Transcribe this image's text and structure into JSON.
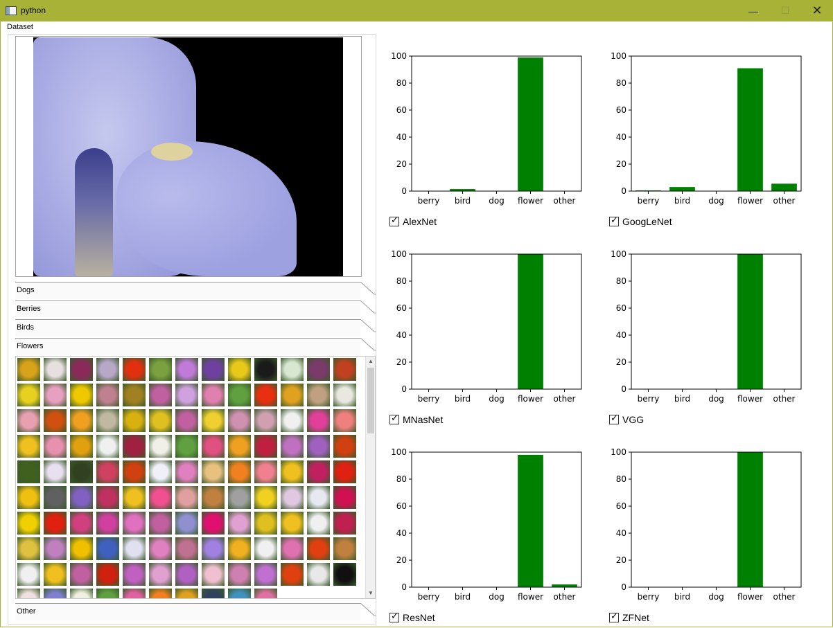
{
  "window": {
    "title": "python"
  },
  "menu": {
    "dataset": "Dataset"
  },
  "sections": {
    "dogs": "Dogs",
    "berries": "Berries",
    "birds": "Birds",
    "flowers": "Flowers",
    "other": "Other"
  },
  "colors": {
    "bar": "#008000",
    "title_bar": "#a8b236"
  },
  "thumb_colors": [
    "#d9a21b",
    "#e8e0e0",
    "#8a2a5a",
    "#b8a8c8",
    "#e03010",
    "#7aa040",
    "#c07ad8",
    "#7040a0",
    "#e8c818",
    "#1a1a1a",
    "#d8e8d0",
    "#7a3a6a",
    "#c04020",
    "#e8d020",
    "#e8a0c0",
    "#f0c800",
    "#c08090",
    "#a08020",
    "#c060a0",
    "#d0a0e0",
    "#e080b0",
    "#60a040",
    "#e83010",
    "#e0a020",
    "#c0a080",
    "#e8e8e0",
    "#e8a0b0",
    "#d05010",
    "#f0a020",
    "#c0b8a0",
    "#d8b010",
    "#e0c020",
    "#c060a0",
    "#f0d030",
    "#d090b0",
    "#d0a0b0",
    "#f0f0f0",
    "#e0409a",
    "#f08080",
    "#f0c020",
    "#e890b0",
    "#e0a010",
    "#f0f0f0",
    "#a02040",
    "#f0f0e8",
    "#60a040",
    "#e05080",
    "#f0a020",
    "#c02040",
    "#c070c0",
    "#a060c0",
    "#d04010",
    "#406020",
    "#e8e0f0",
    "#304020",
    "#d04060",
    "#d04010",
    "#f0f0f8",
    "#e080c0",
    "#e8c080",
    "#f08020",
    "#f08090",
    "#f0c020",
    "#c02060",
    "#e02010",
    "#f0c010",
    "#606060",
    "#8060c0",
    "#c03060",
    "#f0c020",
    "#f05090",
    "#e0a0a0",
    "#c08040",
    "#a0a0a0",
    "#f0d020",
    "#e0c8e0",
    "#e8e8f0",
    "#d01050",
    "#f0d000",
    "#e02010",
    "#d04080",
    "#d040a0",
    "#e070c0",
    "#c060a0",
    "#9090d0",
    "#e01070",
    "#e0a0d0",
    "#e0c020",
    "#f0c020",
    "#f0f0f0",
    "#c02050",
    "#e0c040",
    "#c080c0",
    "#f0c000",
    "#4060c0",
    "#e0e0f0",
    "#e080c0",
    "#c07090",
    "#a080e0",
    "#f0b020",
    "#f0f0f0",
    "#e070b0",
    "#e04010",
    "#c08040",
    "#f0f0f0",
    "#f0c020",
    "#c060a0",
    "#d02010",
    "#c060c0",
    "#e0a0d0",
    "#b060c0",
    "#f0c0d0",
    "#d080b0",
    "#c070d0",
    "#e04010",
    "#e8e8e8",
    "#101010",
    "#f0e0e0",
    "#8080d0",
    "#f0f0e0",
    "#60a040",
    "#e060a0",
    "#f08020",
    "#e0a020",
    "#304060",
    "#4090c0",
    "#e070a0"
  ],
  "charts": [
    {
      "checkbox_label": "AlexNet",
      "checked": true,
      "chart_data": {
        "type": "bar",
        "categories": [
          "berry",
          "bird",
          "dog",
          "flower",
          "other"
        ],
        "values": [
          0,
          1.5,
          0,
          99,
          0
        ],
        "ylim": [
          0,
          100
        ],
        "yticks": [
          0,
          20,
          40,
          60,
          80,
          100
        ]
      }
    },
    {
      "checkbox_label": "GoogLeNet",
      "checked": true,
      "chart_data": {
        "type": "bar",
        "categories": [
          "berry",
          "bird",
          "dog",
          "flower",
          "other"
        ],
        "values": [
          0.5,
          3,
          0,
          91,
          5.5
        ],
        "ylim": [
          0,
          100
        ],
        "yticks": [
          0,
          20,
          40,
          60,
          80,
          100
        ]
      }
    },
    {
      "checkbox_label": "MNasNet",
      "checked": true,
      "chart_data": {
        "type": "bar",
        "categories": [
          "berry",
          "bird",
          "dog",
          "flower",
          "other"
        ],
        "values": [
          0,
          0,
          0,
          100,
          0
        ],
        "ylim": [
          0,
          100
        ],
        "yticks": [
          0,
          20,
          40,
          60,
          80,
          100
        ]
      }
    },
    {
      "checkbox_label": "VGG",
      "checked": true,
      "chart_data": {
        "type": "bar",
        "categories": [
          "berry",
          "bird",
          "dog",
          "flower",
          "other"
        ],
        "values": [
          0,
          0,
          0,
          100,
          0
        ],
        "ylim": [
          0,
          100
        ],
        "yticks": [
          0,
          20,
          40,
          60,
          80,
          100
        ]
      }
    },
    {
      "checkbox_label": "ResNet",
      "checked": true,
      "chart_data": {
        "type": "bar",
        "categories": [
          "berry",
          "bird",
          "dog",
          "flower",
          "other"
        ],
        "values": [
          0,
          0,
          0,
          98,
          2
        ],
        "ylim": [
          0,
          100
        ],
        "yticks": [
          0,
          20,
          40,
          60,
          80,
          100
        ]
      }
    },
    {
      "checkbox_label": "ZFNet",
      "checked": true,
      "chart_data": {
        "type": "bar",
        "categories": [
          "berry",
          "bird",
          "dog",
          "flower",
          "other"
        ],
        "values": [
          0,
          0,
          0,
          100,
          0
        ],
        "ylim": [
          0,
          100
        ],
        "yticks": [
          0,
          20,
          40,
          60,
          80,
          100
        ]
      }
    }
  ]
}
